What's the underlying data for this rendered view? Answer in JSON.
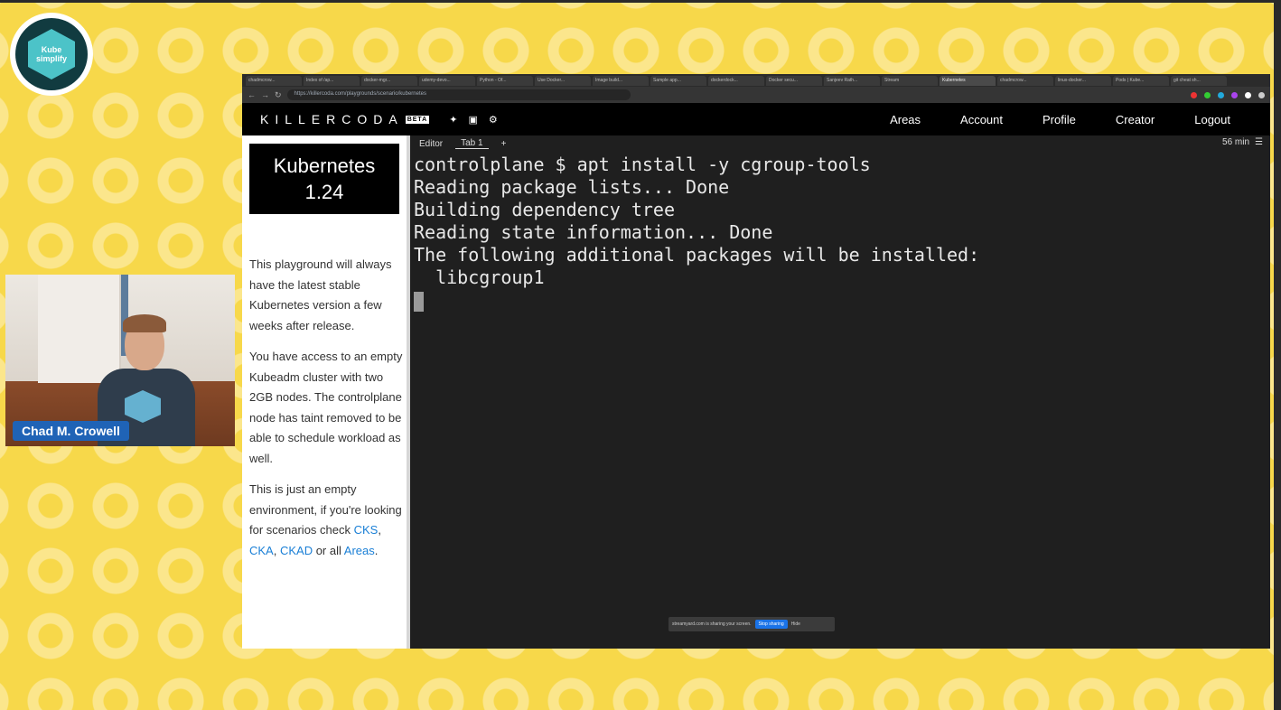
{
  "logo": {
    "line1": "Kube",
    "line2": "simplify"
  },
  "webcam": {
    "name": "Chad M. Crowell"
  },
  "browser": {
    "tabs": [
      "chadmcrow...",
      "Index of /ap...",
      "docker-mgr...",
      "udemy-devo...",
      "Python - Of...",
      "Use Docker...",
      "Image build...",
      "Sample app...",
      "dockerdock...",
      "Docker secu...",
      "Sanjeev Rath...",
      "Stream",
      "Kubernetes",
      "chadmcrow...",
      "linux-docker...",
      "Pods | Kube...",
      "git cheat sh..."
    ],
    "active_tab_index": 12,
    "url": "https://killercoda.com/playgrounds/scenario/kubernetes"
  },
  "header": {
    "logo": "KILLERCODA",
    "beta": "BETA",
    "nav": [
      "Areas",
      "Account",
      "Profile",
      "Creator",
      "Logout"
    ]
  },
  "sidebar": {
    "title_line1": "Kubernetes",
    "title_line2": "1.24",
    "para1": "This playground will always have the latest stable Kubernetes version a few weeks after release.",
    "para2": "You have access to an empty Kubeadm cluster with two 2GB nodes. The controlplane node has taint removed to be able to schedule workload as well.",
    "para3_prefix": "This is just an empty environment, if you're looking for scenarios check ",
    "links": [
      "CKS",
      "CKA",
      "CKAD"
    ],
    "sep1": ", ",
    "sep2": ", ",
    "para3_mid": " or all ",
    "areas_link": "Areas",
    "para3_end": "."
  },
  "terminal": {
    "tabs": [
      "Editor",
      "Tab 1"
    ],
    "add_tab": "+",
    "timer": "56 min",
    "lines": [
      "controlplane $ apt install -y cgroup-tools",
      "Reading package lists... Done",
      "Building dependency tree",
      "Reading state information... Done",
      "The following additional packages will be installed:",
      "  libcgroup1"
    ]
  },
  "share_bar": {
    "message": "streamyard.com is sharing your screen.",
    "stop": "Stop sharing",
    "hide": "Hide"
  },
  "colors": {
    "link": "#1a7fd6",
    "name_tag": "#1f63b6",
    "background": "#f7d84a"
  }
}
